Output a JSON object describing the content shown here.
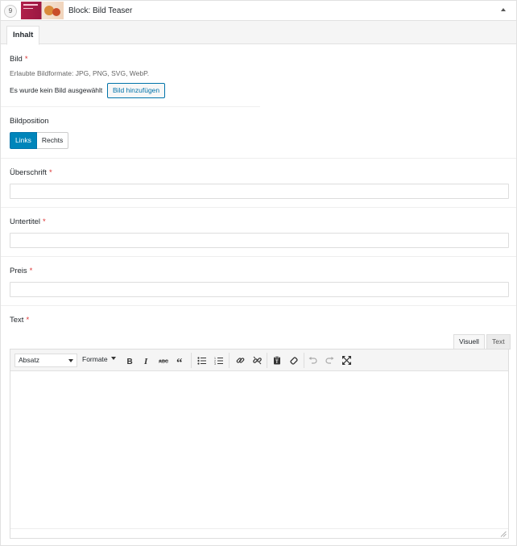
{
  "header": {
    "index": "9",
    "title": "Block: Bild Teaser"
  },
  "tabs": [
    "Inhalt"
  ],
  "bild": {
    "label": "Bild",
    "required": "*",
    "formats": "Erlaubte Bildformate: JPG, PNG, SVG, WebP.",
    "status": "Es wurde kein Bild ausgewählt",
    "button": "Bild hinzufügen"
  },
  "bildposition": {
    "label": "Bildposition",
    "options": [
      "Links",
      "Rechts"
    ],
    "selected": "Links"
  },
  "fields": {
    "ueberschrift": {
      "label": "Überschrift",
      "required": "*",
      "value": ""
    },
    "untertitel": {
      "label": "Untertitel",
      "required": "*",
      "value": ""
    },
    "preis": {
      "label": "Preis",
      "required": "*",
      "value": ""
    }
  },
  "text": {
    "label": "Text",
    "required": "*",
    "mode_tabs": [
      "Visuell",
      "Text"
    ],
    "active_mode": "Visuell",
    "paragraph_select": "Absatz",
    "formats_menu": "Formate",
    "toolbar_icons": [
      "bold-icon",
      "italic-icon",
      "strikethrough-icon",
      "blockquote-icon",
      "bullet-list-icon",
      "numbered-list-icon",
      "link-icon",
      "unlink-icon",
      "paste-text-icon",
      "clear-formatting-icon",
      "undo-icon",
      "redo-icon",
      "fullscreen-icon"
    ],
    "content": ""
  },
  "colors": {
    "accent": "#0085ba",
    "required": "#dc3232",
    "border": "#dddddd"
  }
}
